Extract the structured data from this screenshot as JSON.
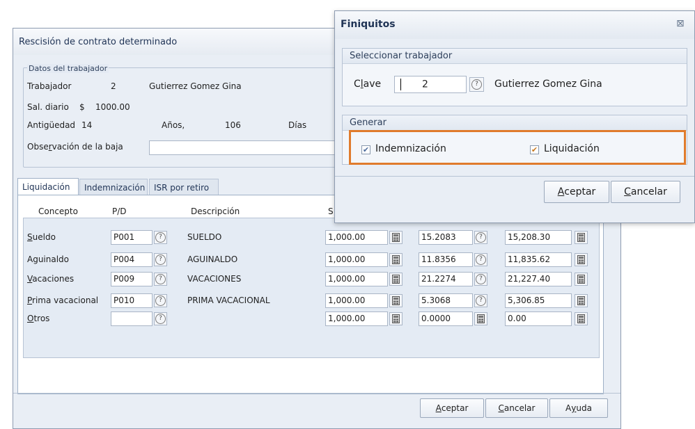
{
  "back": {
    "title": "Rescisión de contrato determinado",
    "datos_title": "Datos del trabajador",
    "trabajador_label": "Trabajador",
    "trabajador_num": "2",
    "trabajador_name": "Gutierrez Gomez Gina",
    "sal_label": "Sal. diario",
    "sal_currency": "$",
    "sal_value": "1000.00",
    "antig_label": "Antigüedad",
    "antig_years": "14",
    "anios_label": "Años,",
    "antig_days": "106",
    "dias_label": "Días",
    "obs_label_pre": "Obse",
    "obs_label_u": "r",
    "obs_label_post": "vación de la baja",
    "tabs": [
      "Liquidación",
      "Indemnización",
      "ISR por retiro"
    ],
    "headers": {
      "concepto": "Concepto",
      "pd": "P/D",
      "descripcion": "Descripción",
      "s": "S"
    },
    "rows": [
      {
        "u": "S",
        "rest": "ueldo",
        "code": "P001",
        "desc": "SUELDO",
        "v1": "1,000.00",
        "v2": "15.2083",
        "v3": "15,208.30"
      },
      {
        "u": "",
        "rest": "Aguinaldo",
        "code": "P004",
        "desc": "AGUINALDO",
        "v1": "1,000.00",
        "v2": "11.8356",
        "v3": "11,835.62"
      },
      {
        "u": "V",
        "rest": "acaciones",
        "code": "P009",
        "desc": "VACACIONES",
        "v1": "1,000.00",
        "v2": "21.2274",
        "v3": "21,227.40"
      },
      {
        "u": "P",
        "rest": "rima vacacional",
        "code": "P010",
        "desc": "PRIMA VACACIONAL",
        "v1": "1,000.00",
        "v2": "5.3068",
        "v3": "5,306.85"
      },
      {
        "u": "O",
        "rest": "tros",
        "code": "",
        "desc": "",
        "v1": "1,000.00",
        "v2": "0.0000",
        "v3": "0.00"
      }
    ],
    "buttons": {
      "aceptar_u": "A",
      "aceptar_rest": "ceptar",
      "cancelar_u": "C",
      "cancelar_rest": "ancelar",
      "ayuda_pre": "A",
      "ayuda_u": "y",
      "ayuda_post": "uda"
    }
  },
  "front": {
    "title": "Finiquitos",
    "close_glyph": "⊠",
    "sel_title": "Seleccionar trabajador",
    "clave_pre": "C",
    "clave_u": "l",
    "clave_post": "ave",
    "clave_value": "2",
    "worker_name": "Gutierrez Gomez Gina",
    "generar_title": "Generar",
    "indemnizacion_label": "Indemnización",
    "indemnizacion_checked": true,
    "liquidacion_label": "Liquidación",
    "liquidacion_checked": true,
    "highlight_color": "#e07b2c",
    "buttons": {
      "aceptar_u": "A",
      "aceptar_rest": "ceptar",
      "cancelar_u": "C",
      "cancelar_rest": "ancelar"
    }
  },
  "icons": {
    "help": "question-icon",
    "calculator": "calculator-icon",
    "checkmark": "✔"
  }
}
